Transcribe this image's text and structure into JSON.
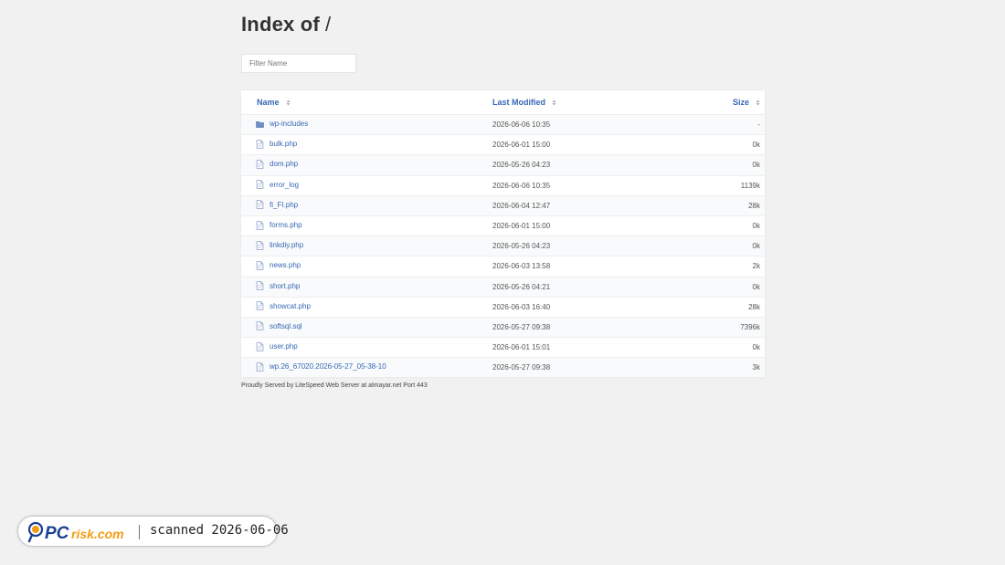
{
  "page": {
    "title_prefix": "Index of",
    "title_path": "/",
    "filter_placeholder": "Filter Name"
  },
  "table": {
    "headers": {
      "name": "Name",
      "modified": "Last Modified",
      "size": "Size"
    },
    "rows": [
      {
        "name": "wp-includes",
        "type": "folder",
        "modified": "2026-06-06 10:35",
        "size": "-"
      },
      {
        "name": "bulk.php",
        "type": "file",
        "modified": "2026-06-01 15:00",
        "size": "0k"
      },
      {
        "name": "dom.php",
        "type": "file",
        "modified": "2026-05-26 04:23",
        "size": "0k"
      },
      {
        "name": "error_log",
        "type": "file",
        "modified": "2026-06-06 10:35",
        "size": "1139k"
      },
      {
        "name": "fi_FI.php",
        "type": "file",
        "modified": "2026-06-04 12:47",
        "size": "28k"
      },
      {
        "name": "forms.php",
        "type": "file",
        "modified": "2026-06-01 15:00",
        "size": "0k"
      },
      {
        "name": "linkdiy.php",
        "type": "file",
        "modified": "2026-05-26 04:23",
        "size": "0k"
      },
      {
        "name": "news.php",
        "type": "file",
        "modified": "2026-06-03 13:58",
        "size": "2k"
      },
      {
        "name": "short.php",
        "type": "file",
        "modified": "2026-05-26 04:21",
        "size": "0k"
      },
      {
        "name": "showcat.php",
        "type": "file",
        "modified": "2026-06-03 16:40",
        "size": "28k"
      },
      {
        "name": "softsql.sql",
        "type": "file",
        "modified": "2026-05-27 09:38",
        "size": "7396k"
      },
      {
        "name": "user.php",
        "type": "file",
        "modified": "2026-06-01 15:01",
        "size": "0k"
      },
      {
        "name": "wp.26_67020.2026-05-27_05-38-10",
        "type": "file",
        "modified": "2026-05-27 09:38",
        "size": "3k"
      }
    ]
  },
  "footer": {
    "text": "Proudly Served by LiteSpeed Web Server at almayar.net Port 443"
  },
  "badge": {
    "logo_text": "PCrisk.com",
    "scan_text": "scanned 2026-06-06"
  },
  "colors": {
    "link": "#3668b5",
    "background": "#f1f1f1",
    "logo_blue": "#1c3f94",
    "logo_orange": "#f39c12"
  }
}
